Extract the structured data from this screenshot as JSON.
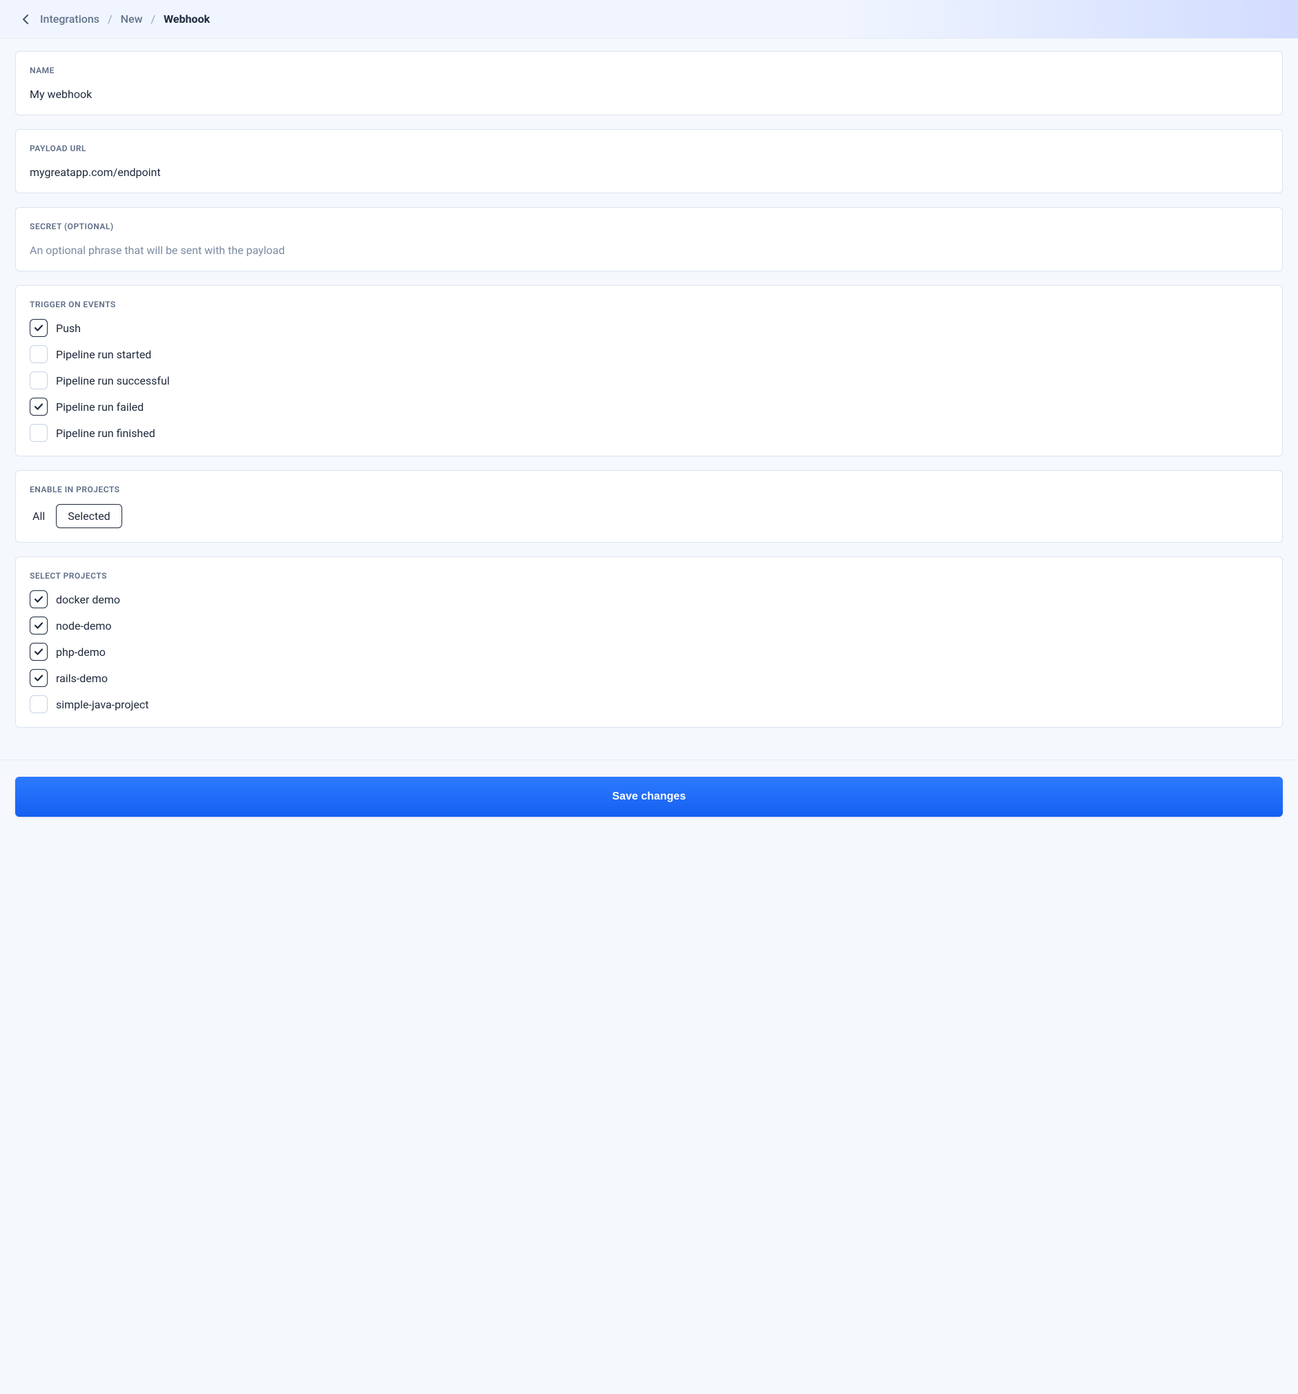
{
  "breadcrumb": {
    "items": [
      "Integrations",
      "New",
      "Webhook"
    ],
    "separator": "/"
  },
  "fields": {
    "name": {
      "label": "NAME",
      "value": "My webhook"
    },
    "payload_url": {
      "label": "PAYLOAD URL",
      "value": "mygreatapp.com/endpoint"
    },
    "secret": {
      "label": "SECRET (OPTIONAL)",
      "value": "",
      "placeholder": "An optional phrase that will be sent with the payload"
    }
  },
  "trigger_events": {
    "label": "TRIGGER ON EVENTS",
    "options": [
      {
        "label": "Push",
        "checked": true
      },
      {
        "label": "Pipeline run started",
        "checked": false
      },
      {
        "label": "Pipeline run successful",
        "checked": false
      },
      {
        "label": "Pipeline run failed",
        "checked": true
      },
      {
        "label": "Pipeline run finished",
        "checked": false
      }
    ]
  },
  "enable_in_projects": {
    "label": "ENABLE IN PROJECTS",
    "options": [
      {
        "label": "All",
        "selected": false
      },
      {
        "label": "Selected",
        "selected": true
      }
    ]
  },
  "select_projects": {
    "label": "SELECT PROJECTS",
    "options": [
      {
        "label": "docker demo",
        "checked": true
      },
      {
        "label": "node-demo",
        "checked": true
      },
      {
        "label": "php-demo",
        "checked": true
      },
      {
        "label": "rails-demo",
        "checked": true
      },
      {
        "label": "simple-java-project",
        "checked": false
      }
    ]
  },
  "actions": {
    "save_label": "Save changes"
  }
}
